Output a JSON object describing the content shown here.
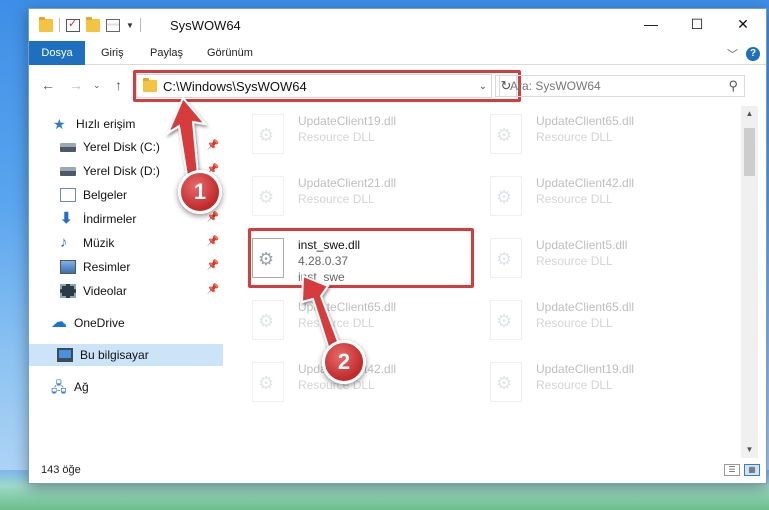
{
  "window": {
    "title": "SysWOW64",
    "controls": {
      "minimize": "—",
      "maximize": "☐",
      "close": "✕"
    }
  },
  "ribbon": {
    "tabs": [
      "Dosya",
      "Giriş",
      "Paylaş",
      "Görünüm"
    ],
    "help": "?"
  },
  "address": {
    "path": "C:\\Windows\\SysWOW64",
    "search_placeholder": "Ara: SysWOW64"
  },
  "nav": {
    "quick_access": "Hızlı erişim",
    "items": [
      {
        "label": "Yerel Disk (C:)",
        "icon": "drive-icon",
        "pinned": true
      },
      {
        "label": "Yerel Disk (D:)",
        "icon": "drive-icon",
        "pinned": true
      },
      {
        "label": "Belgeler",
        "icon": "documents-icon",
        "pinned": true
      },
      {
        "label": "İndirmeler",
        "icon": "downloads-icon",
        "pinned": true
      },
      {
        "label": "Müzik",
        "icon": "music-icon",
        "pinned": true
      },
      {
        "label": "Resimler",
        "icon": "pictures-icon",
        "pinned": true
      },
      {
        "label": "Videolar",
        "icon": "videos-icon",
        "pinned": true
      }
    ],
    "onedrive": "OneDrive",
    "this_pc": "Bu bilgisayar",
    "network": "Ağ"
  },
  "files": {
    "left": [
      {
        "name": "UpdateClient19.dll",
        "sub": "Resource DLL"
      },
      {
        "name": "UpdateClient21.dll",
        "sub": "Resource DLL"
      },
      {
        "name": "inst_swe.dll",
        "sub1": "4.28.0.37",
        "sub2": "inst_swe",
        "selected": true
      },
      {
        "name": "UpdateClient65.dll",
        "sub": "Resource DLL"
      },
      {
        "name": "UpdateClient42.dll",
        "sub": "Resource DLL"
      }
    ],
    "right": [
      {
        "name": "UpdateClient65.dll",
        "sub": "Resource DLL"
      },
      {
        "name": "UpdateClient42.dll",
        "sub": "Resource DLL"
      },
      {
        "name": "UpdateClient5.dll",
        "sub": "Resource DLL"
      },
      {
        "name": "UpdateClient65.dll",
        "sub": "Resource DLL"
      },
      {
        "name": "UpdateClient19.dll",
        "sub": "Resource DLL"
      }
    ]
  },
  "status": {
    "count": "143 öğe"
  },
  "annotations": {
    "step1": "1",
    "step2": "2",
    "color": "#d83b3b"
  }
}
